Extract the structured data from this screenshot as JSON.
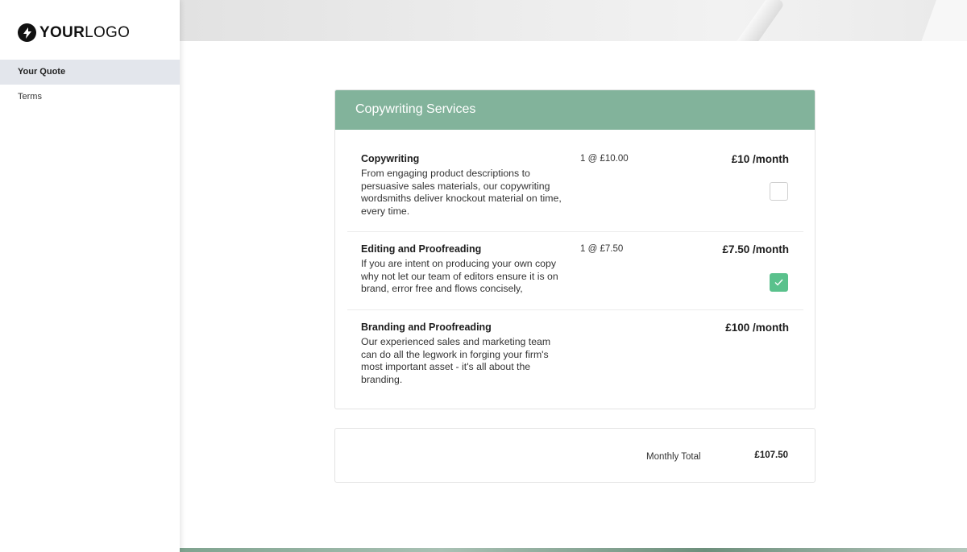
{
  "logo": {
    "bold": "YOUR",
    "light": "LOGO",
    "icon": "lightning-bolt-icon"
  },
  "nav": {
    "items": [
      {
        "label": "Your Quote",
        "active": true
      },
      {
        "label": "Terms",
        "active": false
      }
    ]
  },
  "services": {
    "title": "Copywriting Services",
    "header_color": "#82b39b",
    "items": [
      {
        "name": "Copywriting",
        "description": "From engaging product descriptions to persuasive sales materials, our copywriting wordsmiths deliver knockout material on time, every time.",
        "quantity": "1 @ £10.00",
        "price": "£10 /month",
        "checked": false
      },
      {
        "name": "Editing and Proofreading",
        "description": "If you are intent on producing your own copy why not let our team of editors ensure it is on brand, error free and flows concisely,",
        "quantity": "1 @ £7.50",
        "price": "£7.50 /month",
        "checked": true
      },
      {
        "name": "Branding and Proofreading",
        "description": "Our experienced sales and marketing team can do all the legwork in forging your firm's most important asset - it's all about the branding.",
        "quantity": "",
        "price": "£100 /month"
      }
    ]
  },
  "total": {
    "label": "Monthly Total",
    "value": "£107.50"
  },
  "colors": {
    "checkbox_checked": "#5ac18c",
    "nav_active_bg": "#e3e6ec"
  }
}
